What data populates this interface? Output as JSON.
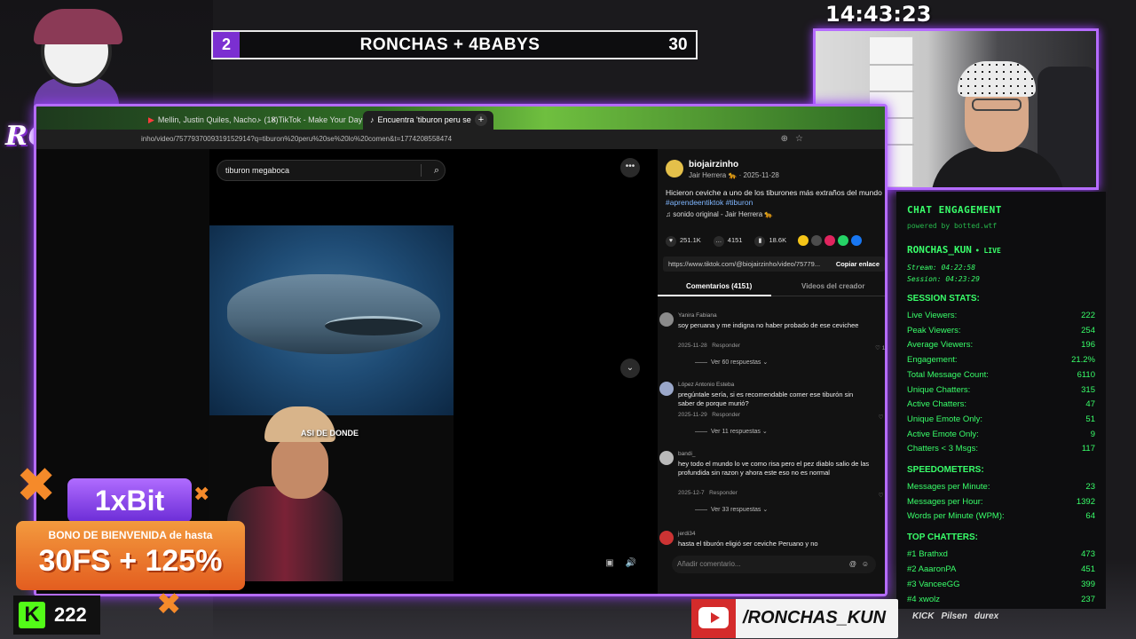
{
  "clock": "14:43:23",
  "scoreboard": {
    "left_score": "2",
    "title": "RONCHAS + 4BABYS",
    "right_score": "30"
  },
  "logo": {
    "text": "RONCHAS"
  },
  "browser": {
    "tabs": [
      {
        "label": "Mellin, Justin Quiles, Nacho -"
      },
      {
        "label": "(18)TikTok - Make Your Day"
      },
      {
        "label": "Encuentra 'tiburon peru se"
      }
    ],
    "url": "inho/video/7577937009319152914?q=tiburon%20peru%20se%20lo%20comen&t=1774208558474"
  },
  "tiktok": {
    "search_value": "tiburon megaboca",
    "overlay_text": "ASI DE DONDE",
    "author_handle": "biojairzinho",
    "author_sub": "Jair Herrera 🐆 · 2025-11-28",
    "caption": "Hicieron ceviche a uno de los tiburones más extraños del mundo",
    "hashtags": "#aprendeentiktok #tiburon",
    "sound": "sonido original - Jair Herrera 🐆",
    "stats": {
      "likes": "251.1K",
      "comments": "4151",
      "saves": "18.6K"
    },
    "share_colors": [
      "#f5c518",
      "#4c4c4c",
      "#e0245e",
      "#25d366",
      "#1877f2"
    ],
    "link": "https://www.tiktok.com/@biojairzinho/video/75779...",
    "copy_link": "Copiar enlace",
    "tab_comments": "Comentarios (4151)",
    "tab_creator": "Videos del creador",
    "comments": [
      {
        "user": "Yanira Fabiana",
        "text": "soy peruana y me indigna no haber probado de ese cevichee",
        "date": "2025-11-28",
        "reply": "Responder",
        "likes": "10",
        "replies": "Ver 60 respuestas"
      },
      {
        "user": "López Antonio Esteba",
        "text": "pregúntale sería, si es recomendable comer ese tiburón sin saber de porque murió?",
        "date": "2025-11-29",
        "reply": "Responder",
        "likes": "1",
        "replies": "Ver 11 respuestas"
      },
      {
        "user": "bandi_",
        "text": "hey todo el mundo lo ve como risa pero el pez diablo salio de las profundida sin razon y ahora este eso no es normal",
        "date": "2025-12-7",
        "reply": "Responder",
        "likes": "6",
        "replies": "Ver 33 respuestas"
      },
      {
        "user": "jerdi34",
        "text": "hasta el tiburón eligió ser ceviche Peruano y no"
      }
    ],
    "comment_placeholder": "Añadir comentario..."
  },
  "chat_panel": {
    "title": "CHAT ENGAGEMENT",
    "powered": "powered by botted.wtf",
    "user": "RONCHAS_KUN",
    "live": "• LIVE",
    "stream": "Stream: 04:22:58",
    "session": "Session: 04:23:29",
    "section_session": "SESSION STATS:",
    "session_stats": [
      {
        "label": "Live Viewers:",
        "value": "222"
      },
      {
        "label": "Peak Viewers:",
        "value": "254"
      },
      {
        "label": "Average Viewers:",
        "value": "196"
      },
      {
        "label": "Engagement:",
        "value": "21.2%"
      },
      {
        "label": "Total Message Count:",
        "value": "6110"
      },
      {
        "label": "Unique Chatters:",
        "value": "315"
      },
      {
        "label": "Active Chatters:",
        "value": "47"
      },
      {
        "label": "Unique Emote Only:",
        "value": "51"
      },
      {
        "label": "Active Emote Only:",
        "value": "9"
      },
      {
        "label": "Chatters < 3 Msgs:",
        "value": "117"
      }
    ],
    "section_speed": "SPEEDOMETERS:",
    "speed_stats": [
      {
        "label": "Messages per Minute:",
        "value": "23"
      },
      {
        "label": "Messages per Hour:",
        "value": "1392"
      },
      {
        "label": "Words per Minute (WPM):",
        "value": "64"
      }
    ],
    "section_top": "TOP CHATTERS:",
    "top_chatters": [
      {
        "label": "#1 Brathxd",
        "value": "473"
      },
      {
        "label": "#2 AaaronPA",
        "value": "451"
      },
      {
        "label": "#3 VanceeGG",
        "value": "399"
      },
      {
        "label": "#4 xwolz",
        "value": "237"
      }
    ]
  },
  "sponsor": {
    "brand": "1xBit",
    "line1": "BONO DE BIENVENIDA de hasta",
    "line2": "30FS + 125%"
  },
  "kick": {
    "viewers": "222"
  },
  "youtube": {
    "handle": "/RONCHAS_KUN"
  },
  "sponsor_logos": [
    "KICK",
    "Pilsen",
    "durex"
  ]
}
